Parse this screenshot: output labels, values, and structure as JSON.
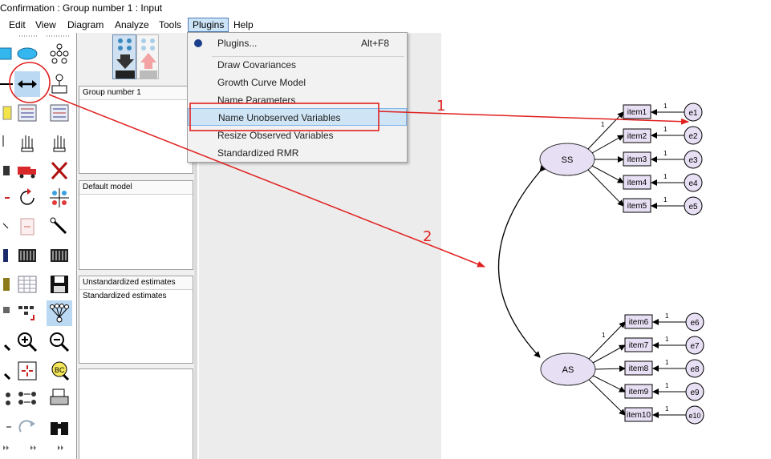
{
  "window": {
    "title": "Confirmation : Group number 1 : Input"
  },
  "menu": {
    "items": [
      "Edit",
      "View",
      "Diagram",
      "Analyze",
      "Tools",
      "Plugins",
      "Help"
    ],
    "active": "Plugins"
  },
  "plugins_menu": {
    "items": [
      {
        "label": "Plugins...",
        "accel": "Alt+F8"
      },
      {
        "label": "Draw Covariances",
        "accel": ""
      },
      {
        "label": "Growth Curve Model",
        "accel": ""
      },
      {
        "label": "Name Parameters",
        "accel": ""
      },
      {
        "label": "Name Unobserved Variables",
        "accel": ""
      },
      {
        "label": "Resize Observed Variables",
        "accel": ""
      },
      {
        "label": "Standardized RMR",
        "accel": ""
      }
    ],
    "highlighted": "Name Unobserved Variables"
  },
  "panels": {
    "groups": {
      "header": "Group number 1"
    },
    "models": {
      "header": "Default model"
    },
    "estimates": {
      "header": "Unstandardized estimates",
      "rows": [
        "Standardized estimates"
      ]
    }
  },
  "diagram": {
    "latent": [
      "SS",
      "AS"
    ],
    "observed": [
      "item1",
      "item2",
      "item3",
      "item4",
      "item5",
      "item6",
      "item7",
      "item8",
      "item9",
      "item10"
    ],
    "errors": [
      "e1",
      "e2",
      "e3",
      "e4",
      "e5",
      "e6",
      "e7",
      "e8",
      "e9",
      "e10"
    ],
    "fixed_loading_label": "1",
    "error_path_label": "1"
  },
  "annotations": {
    "marks": [
      "1",
      "2"
    ],
    "color": "#e0201e"
  },
  "icons": [
    "rectangle-icon",
    "ellipse-icon",
    "indicator-icon",
    "double-arrow-icon",
    "unique-variable-icon",
    "title-icon",
    "list-variables-icon",
    "hand-icon",
    "truck-icon",
    "delete-icon",
    "rotate-icon",
    "reflect-icon",
    "magic-wand-icon",
    "spreadsheet-icon",
    "save-icon",
    "zoom-in-icon",
    "zoom-out-icon",
    "fit-icon",
    "bc-icon",
    "print-icon",
    "binoculars-icon"
  ]
}
